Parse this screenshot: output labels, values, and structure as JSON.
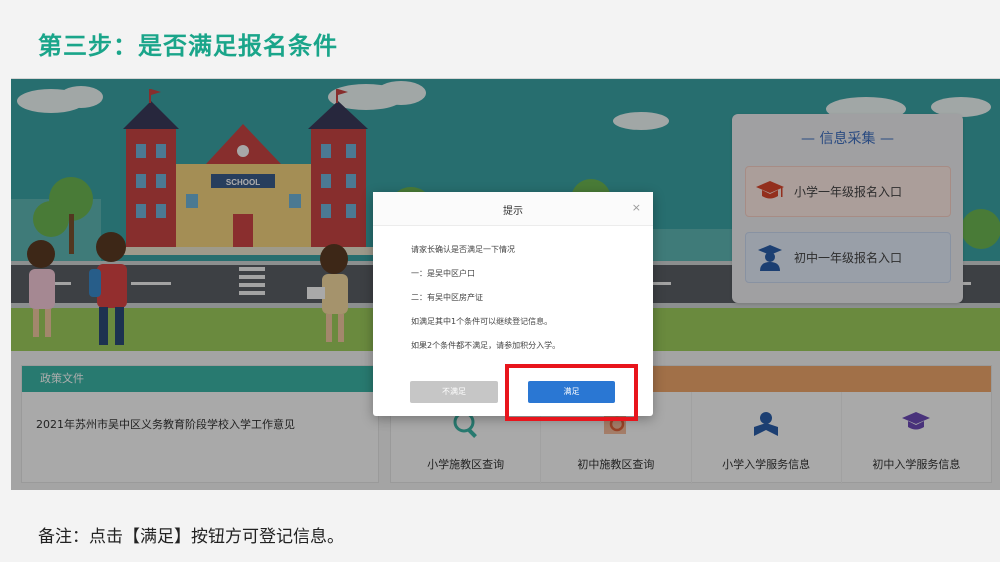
{
  "slide": {
    "title": "第三步：是否满足报名条件",
    "note": "备注：点击【满足】按钮方可登记信息。"
  },
  "banner": {
    "school_sign": "SCHOOL"
  },
  "info_card": {
    "title": "— 信息采集 —",
    "entries": [
      {
        "label": "小学一年级报名入口",
        "icon": "graduation-cap-icon"
      },
      {
        "label": "初中一年级报名入口",
        "icon": "graduate-student-icon"
      }
    ]
  },
  "policy": {
    "header": "政策文件",
    "items": [
      "2021年苏州市吴中区义务教育阶段学校入学工作意见"
    ]
  },
  "services": [
    {
      "label": "小学施教区查询",
      "icon": "search-map-icon"
    },
    {
      "label": "初中施教区查询",
      "icon": "map-search-icon"
    },
    {
      "label": "小学入学服务信息",
      "icon": "student-reading-icon"
    },
    {
      "label": "初中入学服务信息",
      "icon": "diploma-cap-icon"
    }
  ],
  "dialog": {
    "title": "提示",
    "close": "×",
    "lines": [
      "请家长确认是否满足一下情况",
      "一：是吴中区户口",
      "二：有吴中区房产证",
      "如满足其中1个条件可以继续登记信息。",
      "如果2个条件都不满足，请参加积分入学。"
    ],
    "buttons": {
      "reject": "不满足",
      "confirm": "满足"
    }
  },
  "colors": {
    "title_green": "#1aa58a",
    "confirm_blue": "#2a77d3",
    "highlight_red": "#e8151c",
    "policy_header": "#3cb4a5",
    "service_header": "#eda56b"
  }
}
